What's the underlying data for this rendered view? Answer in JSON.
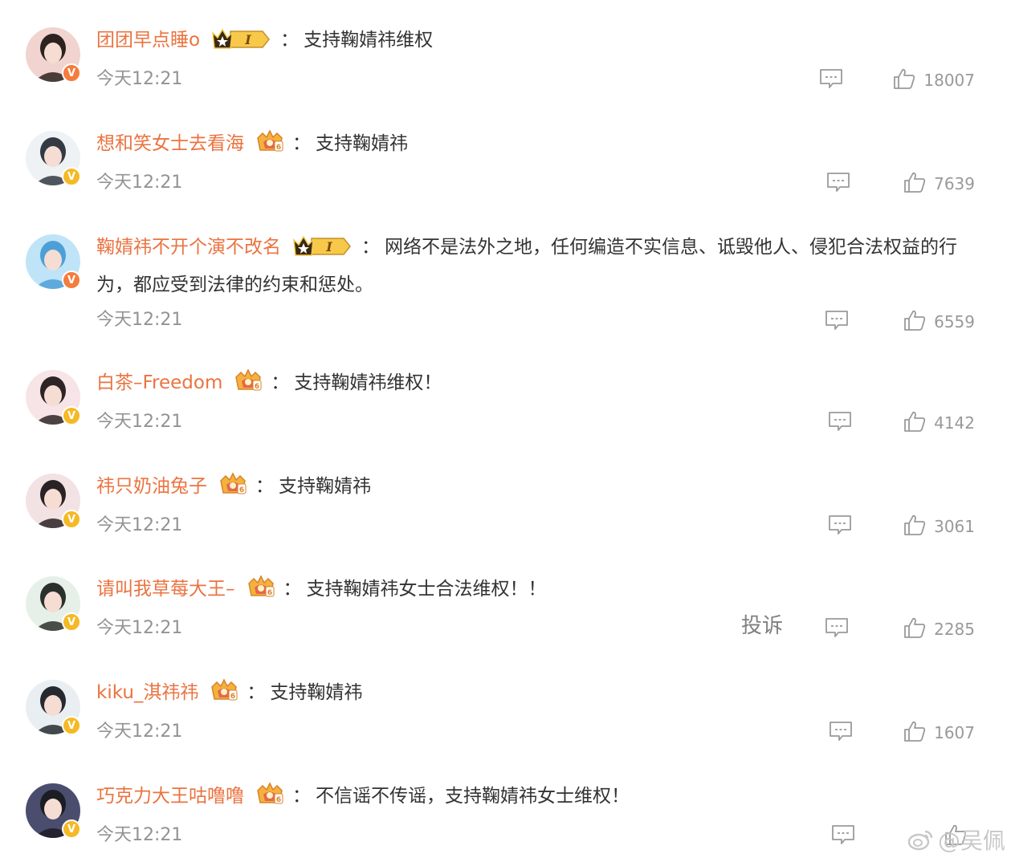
{
  "comments": [
    {
      "username": "团团早点睡o",
      "level": "I",
      "level_type": "gold",
      "text": "支持鞠婧祎维权",
      "time": "今天12:21",
      "likes": "18007",
      "badge_color": "#f47c3c",
      "avatar_colors": [
        "#f1d4cf",
        "#2c2220"
      ]
    },
    {
      "username": "想和笑女士去看海",
      "level": "6",
      "level_type": "crown",
      "text": "支持鞠婧祎",
      "time": "今天12:21",
      "likes": "7639",
      "badge_color": "#f5b925",
      "avatar_colors": [
        "#eef2f4",
        "#333a44"
      ]
    },
    {
      "username": "鞠婧祎不开个演不改名",
      "level": "I",
      "level_type": "gold",
      "text": "网络不是法外之地，任何编造不实信息、诋毁他人、侵犯合法权益的行为，都应受到法律的约束和惩处。",
      "time": "今天12:21",
      "likes": "6559",
      "badge_color": "#f47c3c",
      "avatar_colors": [
        "#bfe4f7",
        "#4d9fd8"
      ]
    },
    {
      "username": "白茶–Freedom",
      "level": "6",
      "level_type": "crown",
      "text": "支持鞠婧祎维权！",
      "time": "今天12:21",
      "likes": "4142",
      "badge_color": "#f5b925",
      "avatar_colors": [
        "#f6e4e6",
        "#2e2426"
      ]
    },
    {
      "username": "祎只奶油兔子",
      "level": "6",
      "level_type": "crown",
      "text": "支持鞠婧祎",
      "time": "今天12:21",
      "likes": "3061",
      "badge_color": "#f5b925",
      "avatar_colors": [
        "#f3e2e4",
        "#2a2224"
      ]
    },
    {
      "username": "请叫我草莓大王–",
      "level": "6",
      "level_type": "crown",
      "text": "支持鞠婧祎女士合法维权！！",
      "time": "今天12:21",
      "likes": "2285",
      "badge_color": "#f5b925",
      "avatar_colors": [
        "#e6f0e8",
        "#2b302c"
      ],
      "report": "投诉"
    },
    {
      "username": "kiku_淇祎祎",
      "level": "6",
      "level_type": "crown",
      "text": "支持鞠婧祎",
      "time": "今天12:21",
      "likes": "1607",
      "badge_color": "#f5b925",
      "avatar_colors": [
        "#e8eef2",
        "#262a30"
      ]
    },
    {
      "username": "巧克力大王咕噜噜",
      "level": "6",
      "level_type": "crown",
      "text": "不信谣不传谣，支持鞠婧祎女士维权！",
      "time": "今天12:21",
      "likes": "",
      "badge_color": "#f5b925",
      "avatar_colors": [
        "#4a4d6e",
        "#1c1c24"
      ]
    }
  ],
  "watermark": "@吴佩",
  "icons": {
    "comment": "comment-icon",
    "like": "thumbs-up-icon",
    "verified": "verified-v-icon",
    "level": "vip-level-icon"
  },
  "colors": {
    "username": "#eb7340",
    "text": "#333333",
    "meta": "#939393",
    "like_count": "#999999"
  }
}
